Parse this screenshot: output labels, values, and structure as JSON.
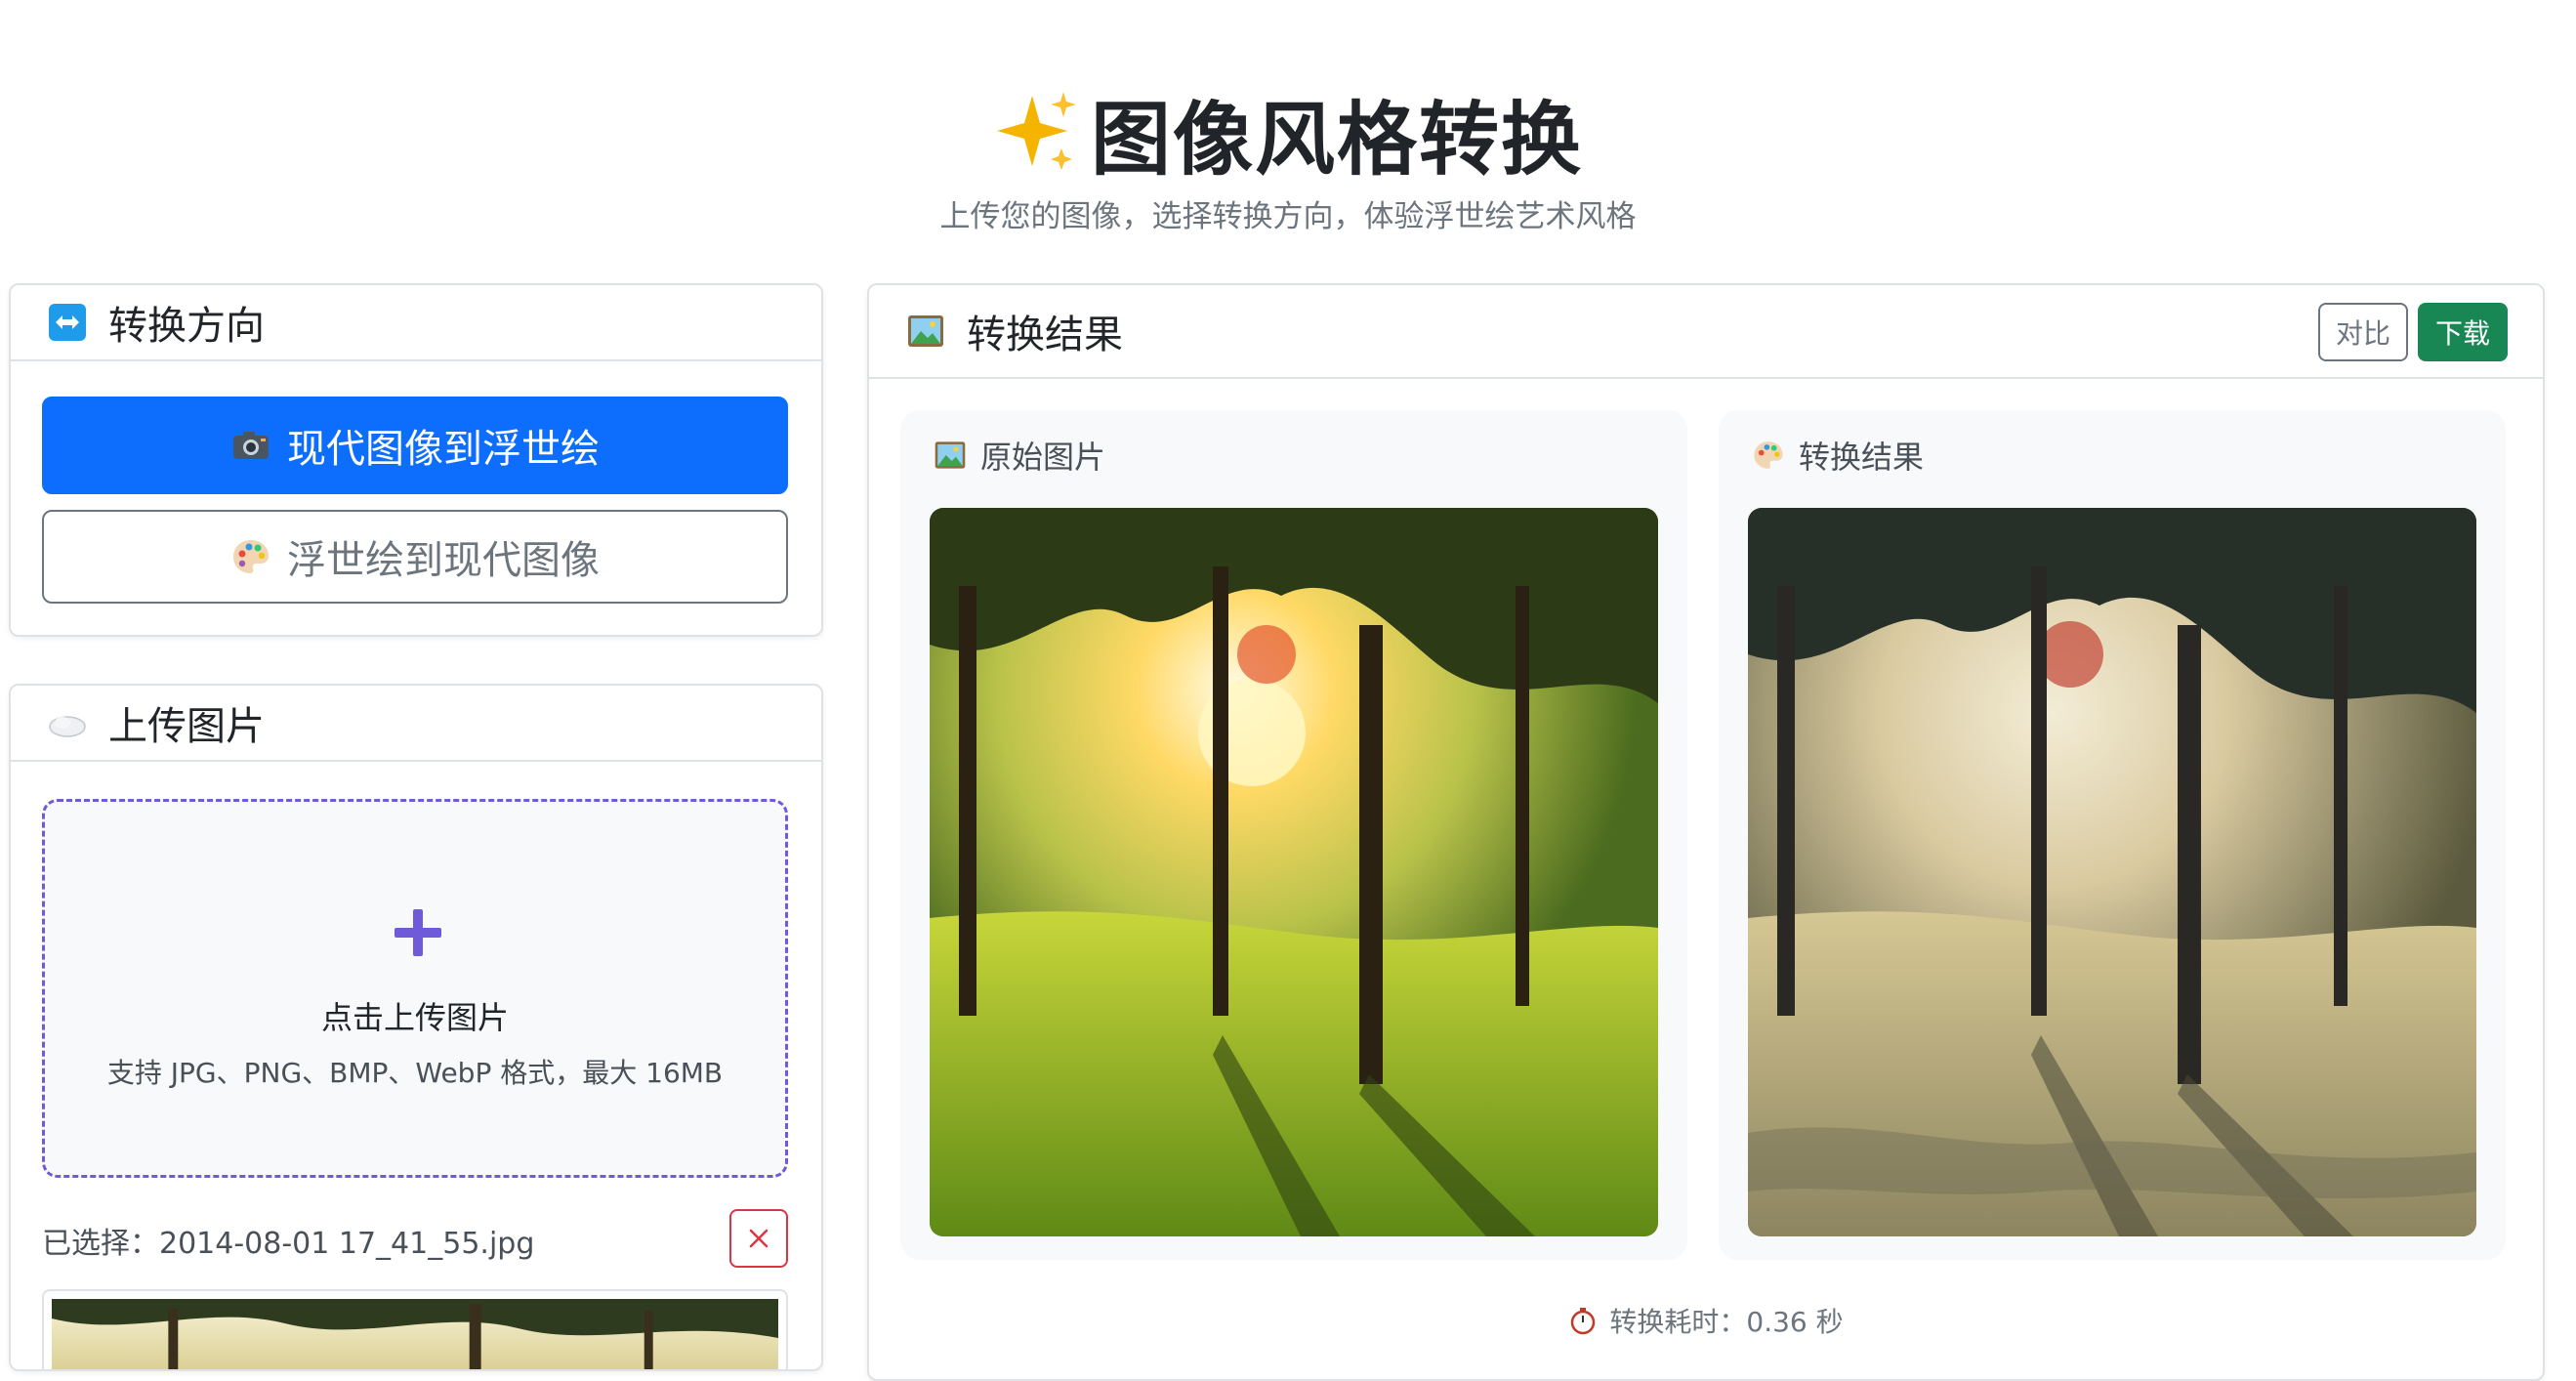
{
  "header": {
    "title": "图像风格转换",
    "subtitle": "上传您的图像，选择转换方向，体验浮世绘艺术风格"
  },
  "direction": {
    "title": "转换方向",
    "modern_to_ukiyoe": "现代图像到浮世绘",
    "ukiyoe_to_modern": "浮世绘到现代图像",
    "active": "modern_to_ukiyoe"
  },
  "upload": {
    "title": "上传图片",
    "drop_title": "点击上传图片",
    "drop_hint": "支持 JPG、PNG、BMP、WebP 格式，最大 16MB",
    "selected_file": "已选择：2014-08-01 17_41_55.jpg"
  },
  "result": {
    "title": "转换结果",
    "compare_label": "对比",
    "download_label": "下载",
    "original_label": "原始图片",
    "converted_label": "转换结果",
    "timing": "转换耗时：0.36 秒"
  },
  "colors": {
    "primary": "#0d6efd",
    "success": "#198754",
    "danger": "#dc3545",
    "dropzone_border": "#6f5bd9"
  },
  "icons": {
    "title": "sparkles-icon",
    "direction": "left-right-arrow-icon",
    "modern": "camera-icon",
    "ukiyoe": "palette-icon",
    "upload": "cloud-icon",
    "dropzone": "plus-icon",
    "remove": "close-icon",
    "original": "picture-icon",
    "converted": "palette-icon",
    "timing": "stopwatch-icon"
  }
}
